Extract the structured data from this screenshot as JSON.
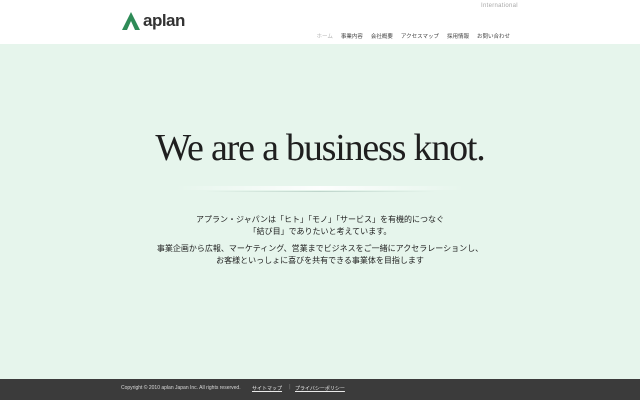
{
  "header": {
    "logo_text": "aplan",
    "logo_color": "#2e8b57",
    "international": "International",
    "nav": [
      {
        "label": "ホーム",
        "active": true
      },
      {
        "label": "事業内容",
        "active": false
      },
      {
        "label": "会社概要",
        "active": false
      },
      {
        "label": "アクセスマップ",
        "active": false
      },
      {
        "label": "採用情報",
        "active": false
      },
      {
        "label": "お問い合わせ",
        "active": false
      }
    ]
  },
  "hero": {
    "tagline": "We are a business knot.",
    "intro_lines_1": [
      "アプラン・ジャパンは「ヒト」「モノ」「サービス」を有機的につなぐ",
      "「結び目」でありたいと考えています。"
    ],
    "intro_lines_2": [
      "事業企画から広報、マーケティング、営業までビジネスをご一緒にアクセラレーションし、",
      "お客様といっしょに喜びを共有できる事業体を目指します"
    ]
  },
  "footer": {
    "copyright": "Copyright © 2010 aplan Japan Inc. All rights reserved.",
    "links": [
      "サイトマップ",
      "プライバシーポリシー"
    ],
    "separator": "|"
  }
}
